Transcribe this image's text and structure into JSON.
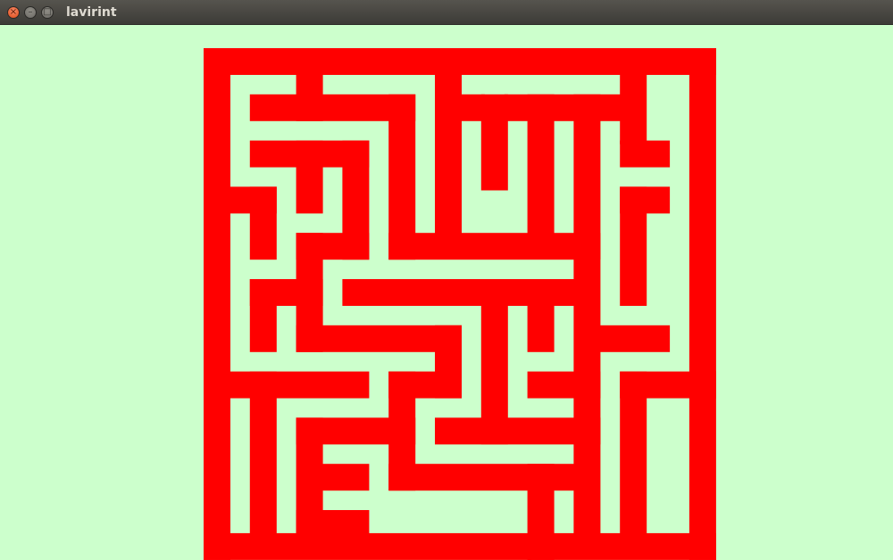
{
  "window": {
    "title": "lavirint",
    "icons": {
      "close": "close-icon",
      "minimize": "minimize-icon",
      "maximize": "maximize-icon"
    },
    "glyphs": {
      "close": "×",
      "minimize": "–",
      "maximize": "□"
    }
  },
  "game": {
    "background_color": "#ccffcc",
    "wall_color": "#ff0000",
    "grid_size": 10
  }
}
